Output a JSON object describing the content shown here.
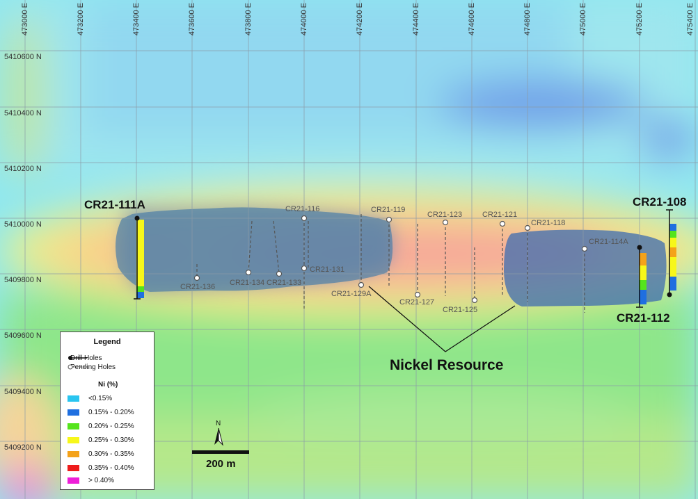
{
  "map": {
    "x_ticks": [
      "473000 E",
      "473200 E",
      "473400 E",
      "473600 E",
      "473800 E",
      "474000 E",
      "474200 E",
      "474400 E",
      "474600 E",
      "474800 E",
      "475000 E",
      "475200 E",
      "475400 E"
    ],
    "y_ticks": [
      "5410600 N",
      "5410400 N",
      "5410200 N",
      "5410000 N",
      "5409800 N",
      "5409600 N",
      "5409400 N",
      "5409200 N"
    ]
  },
  "drill_holes": {
    "main": [
      {
        "name": "CR21-111A"
      },
      {
        "name": "CR21-108"
      },
      {
        "name": "CR21-112"
      }
    ],
    "pending": [
      "CR21-116",
      "CR21-119",
      "CR21-123",
      "CR21-121",
      "CR21-118",
      "CR21-114A",
      "CR21-136",
      "CR21-134",
      "CR21-133",
      "CR21-131",
      "CR21-129A",
      "CR21-127",
      "CR21-125"
    ]
  },
  "annotation": {
    "nickel_resource": "Nickel Resource"
  },
  "legend": {
    "title": "Legend",
    "drill_holes": "Drill Holes",
    "pending_holes": "Pending Holes",
    "ni_title": "Ni (%)",
    "items": [
      {
        "label": "<0.15%",
        "color": "#29c5f0"
      },
      {
        "label": "0.15% - 0.20%",
        "color": "#1f6fe0"
      },
      {
        "label": "0.20% - 0.25%",
        "color": "#55e41c"
      },
      {
        "label": "0.25% - 0.30%",
        "color": "#f7f71a"
      },
      {
        "label": "0.30% - 0.35%",
        "color": "#f4a21a"
      },
      {
        "label": "0.35% - 0.40%",
        "color": "#ee1c1c"
      },
      {
        "label": "> 0.40%",
        "color": "#ee1ed8"
      }
    ]
  },
  "scale_bar": {
    "label": "200 m",
    "north": "N"
  }
}
